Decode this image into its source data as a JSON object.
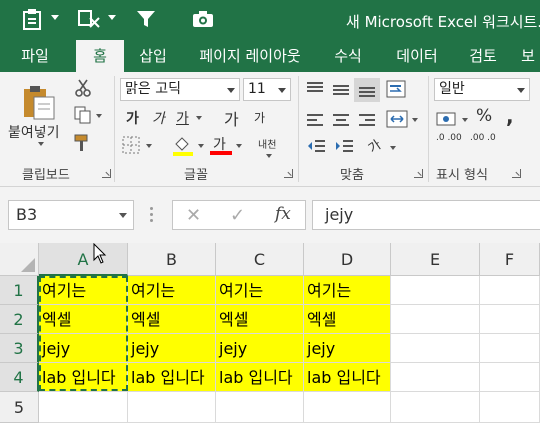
{
  "window": {
    "title": "새 Microsoft Excel 워크시트.x",
    "accent": "#217346"
  },
  "quick_access": [
    {
      "icon": "clipboard-icon"
    },
    {
      "icon": "clear-format-icon"
    },
    {
      "icon": "filter-icon"
    },
    {
      "icon": "camera-icon"
    }
  ],
  "tabs": [
    {
      "label": "파일",
      "active": false
    },
    {
      "label": "홈",
      "active": true
    },
    {
      "label": "삽입",
      "active": false
    },
    {
      "label": "페이지 레이아웃",
      "active": false
    },
    {
      "label": "수식",
      "active": false
    },
    {
      "label": "데이터",
      "active": false
    },
    {
      "label": "검토",
      "active": false
    },
    {
      "label": "보",
      "active": false
    }
  ],
  "ribbon": {
    "clipboard": {
      "label": "클립보드",
      "paste_label": "붙여넣기"
    },
    "font": {
      "label": "글꼴",
      "font_name": "맑은 고딕",
      "font_size": "11",
      "bold": "가",
      "italic": "가",
      "underline": "가",
      "grow": "가",
      "shrink": "가",
      "font_color_glyph": "가",
      "phonetic": "내천",
      "fill_color": "#ffff00",
      "font_color": "#ff0000"
    },
    "alignment": {
      "label": "맞춤",
      "orientation_glyph": "가"
    },
    "number": {
      "label": "표시 형식",
      "format": "일반",
      "percent": "%",
      "inc_decimal": ".0 .00",
      "dec_decimal": ".00 .0"
    }
  },
  "formula_bar": {
    "name_box": "B3",
    "cancel": "✕",
    "enter": "✓",
    "fx": "fx",
    "value": "jejy"
  },
  "sheet": {
    "columns": [
      "A",
      "B",
      "C",
      "D",
      "E",
      "F"
    ],
    "selected_column": "A",
    "rows": [
      "1",
      "2",
      "3",
      "4",
      "5"
    ],
    "fill_color": "#ffff00",
    "cells": [
      [
        "여기는",
        "여기는",
        "여기는",
        "여기는",
        "",
        ""
      ],
      [
        "엑셀",
        "엑셀",
        "엑셀",
        "엑셀",
        "",
        ""
      ],
      [
        "jejy",
        "jejy",
        "jejy",
        "jejy",
        "",
        ""
      ],
      [
        "lab 입니다",
        "lab 입니다",
        "lab 입니다",
        "lab 입니다",
        "",
        ""
      ],
      [
        "",
        "",
        "",
        "",
        "",
        ""
      ]
    ]
  }
}
